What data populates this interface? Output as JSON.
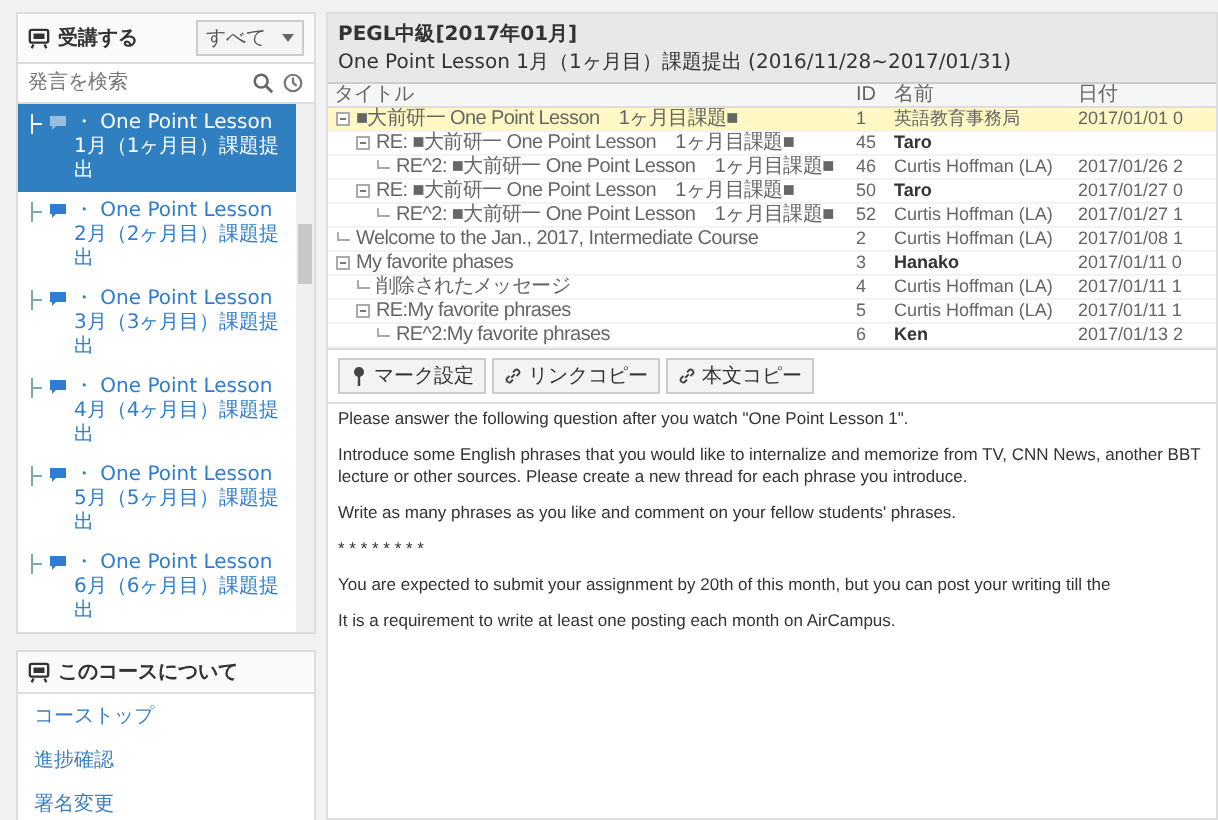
{
  "sidebar": {
    "header": {
      "title": "受講する",
      "filter": "すべて"
    },
    "search": {
      "placeholder": "発言を検索"
    },
    "items": [
      {
        "label": "・ One Point Lesson 1月（1ヶ月目）課題提出",
        "selected": true
      },
      {
        "label": "・ One Point Lesson 2月（2ヶ月目）課題提出",
        "selected": false
      },
      {
        "label": "・ One Point Lesson 3月（3ヶ月目）課題提出",
        "selected": false
      },
      {
        "label": "・ One Point Lesson 4月（4ヶ月目）課題提出",
        "selected": false
      },
      {
        "label": "・ One Point Lesson 5月（5ヶ月目）課題提出",
        "selected": false
      },
      {
        "label": "・ One Point Lesson 6月（6ヶ月目）課題提出",
        "selected": false
      }
    ],
    "about": {
      "title": "このコースについて",
      "links": [
        "コーストップ",
        "進捗確認",
        "署名変更"
      ]
    }
  },
  "thread": {
    "title": "PEGL中級[2017年01月]",
    "subtitle": "One Point Lesson 1月（1ヶ月目）課題提出 (2016/11/28~2017/01/31)",
    "columns": [
      "タイトル",
      "ID",
      "名前",
      "日付"
    ],
    "rows": [
      {
        "title": "■大前研一 One Point Lesson　1ヶ月目課題■",
        "id": "1",
        "name": "英語教育事務局",
        "date": "2017/01/01 0",
        "unread": false,
        "selected": true,
        "children": [
          {
            "title": "RE: ■大前研一 One Point Lesson　1ヶ月目課題■",
            "id": "45",
            "name": "Taro",
            "unread": true,
            "selected": false,
            "children": [
              {
                "title": "RE^2: ■大前研一 One Point Lesson　1ヶ月目課題■",
                "id": "46",
                "name": "Curtis Hoffman (LA)",
                "date": "2017/01/26 2",
                "unread": false,
                "selected": false
              }
            ]
          },
          {
            "title": "RE: ■大前研一 One Point Lesson　1ヶ月目課題■",
            "id": "50",
            "name": "Taro",
            "date": "2017/01/27 0",
            "unread": true,
            "selected": false,
            "children": [
              {
                "title": "RE^2: ■大前研一 One Point Lesson　1ヶ月目課題■",
                "id": "52",
                "name": "Curtis Hoffman (LA)",
                "date": "2017/01/27 1",
                "unread": false,
                "selected": false
              }
            ]
          }
        ]
      },
      {
        "title": "Welcome to the Jan., 2017, Intermediate Course",
        "id": "2",
        "name": "Curtis Hoffman (LA)",
        "date": "2017/01/08 1",
        "unread": false,
        "selected": false
      },
      {
        "title": "My favorite phases",
        "id": "3",
        "name": "Hanako",
        "date": "2017/01/11 0",
        "unread": true,
        "selected": false,
        "children": [
          {
            "title": "削除されたメッセージ",
            "id": "4",
            "name": "Curtis Hoffman (LA)",
            "date": "2017/01/11 1",
            "unread": false,
            "selected": false
          },
          {
            "title": "RE:My favorite phrases",
            "id": "5",
            "name": "Curtis Hoffman (LA)",
            "date": "2017/01/11 1",
            "unread": false,
            "selected": false,
            "children": [
              {
                "title": "RE^2:My favorite phrases",
                "id": "6",
                "name": "Ken",
                "date": "2017/01/13 2",
                "unread": true,
                "selected": false
              }
            ]
          }
        ]
      }
    ],
    "toolbar": [
      {
        "kind": "pin",
        "label": "マーク設定"
      },
      {
        "kind": "link",
        "label": "リンクコピー"
      },
      {
        "kind": "link",
        "label": "本文コピー"
      }
    ],
    "body": [
      "Please answer the following question after you watch \"One Point Lesson 1\".",
      "Introduce some English phrases that you would like to internalize and memorize from TV, CNN News, another BBT lecture or other  sources.  Please create a new thread for each phrase you introduce.",
      "Write as many phrases as you like and comment on your fellow students' phrases.",
      "* * * * * * * *",
      "You are expected to submit your assignment by 20th of this month, but you can post your writing till the",
      "It is a requirement to write at least one posting each month on AirCampus."
    ]
  }
}
